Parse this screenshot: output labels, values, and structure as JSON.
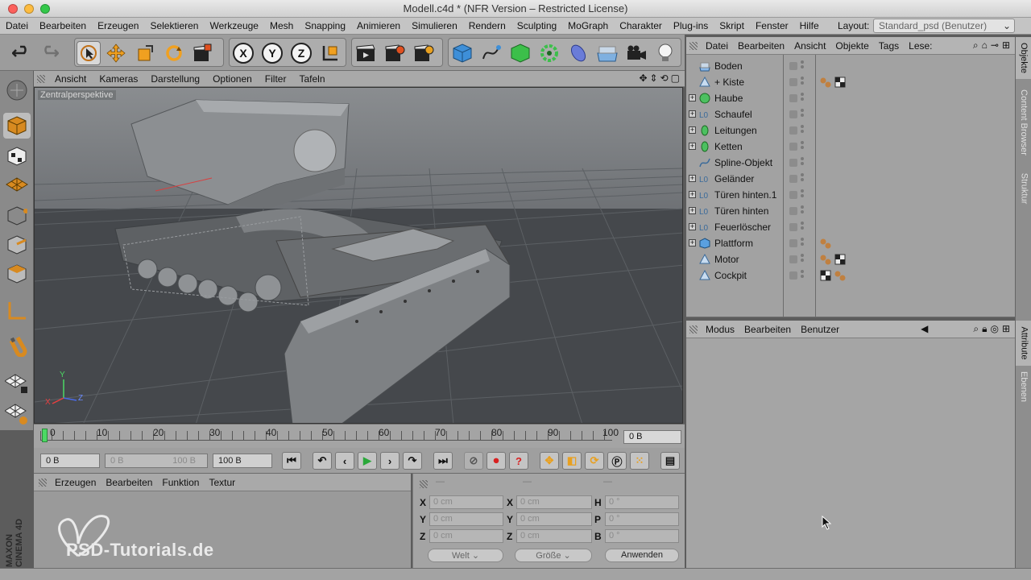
{
  "window": {
    "title": "Modell.c4d * (NFR Version – Restricted License)"
  },
  "menubar": {
    "items": [
      "Datei",
      "Bearbeiten",
      "Erzeugen",
      "Selektieren",
      "Werkzeuge",
      "Mesh",
      "Snapping",
      "Animieren",
      "Simulieren",
      "Rendern",
      "Sculpting",
      "MoGraph",
      "Charakter",
      "Plug-ins",
      "Skript",
      "Fenster",
      "Hilfe"
    ],
    "layout_label": "Layout:",
    "layout_value": "Standard_psd (Benutzer)"
  },
  "toolbar": {
    "axis_x": "X",
    "axis_y": "Y",
    "axis_z": "Z"
  },
  "viewport": {
    "menu": [
      "Ansicht",
      "Kameras",
      "Darstellung",
      "Optionen",
      "Filter",
      "Tafeln"
    ],
    "label": "Zentralperspektive",
    "axis_labels": {
      "x": "X",
      "y": "Y",
      "z": "Z"
    }
  },
  "timeline": {
    "ticks": [
      "0",
      "10",
      "20",
      "30",
      "40",
      "50",
      "60",
      "70",
      "80",
      "90",
      "100"
    ],
    "current_frame": "0 B"
  },
  "transport": {
    "start": "0 B",
    "range_start": "0 B",
    "range_end": "100 B",
    "end": "100 B"
  },
  "material_manager": {
    "menu": [
      "Erzeugen",
      "Bearbeiten",
      "Funktion",
      "Textur"
    ]
  },
  "coordinates": {
    "labels": [
      "X",
      "Y",
      "Z",
      "X",
      "Y",
      "Z",
      "H",
      "P",
      "B"
    ],
    "position": [
      "0 cm",
      "0 cm",
      "0 cm"
    ],
    "size": [
      "0 cm",
      "0 cm",
      "0 cm"
    ],
    "rotation": [
      "0 °",
      "0 °",
      "0 °"
    ],
    "headers": [
      "—",
      "—",
      "—"
    ],
    "mode": "Welt",
    "size_mode": "Größe",
    "apply": "Anwenden"
  },
  "branding": {
    "maxon": "MAXON CINEMA 4D",
    "watermark": "PSD-Tutorials.de"
  },
  "object_manager": {
    "menu": [
      "Datei",
      "Bearbeiten",
      "Ansicht",
      "Objekte",
      "Tags",
      "Lese:"
    ],
    "objects": [
      {
        "name": "Boden",
        "icon": "floor-icon",
        "expand": false,
        "tags": []
      },
      {
        "name": "+ Kiste",
        "icon": "polygon-icon",
        "expand": false,
        "tags": [
          "material-tag",
          "checker-tag"
        ]
      },
      {
        "name": "Haube",
        "icon": "generator-icon",
        "expand": true,
        "tags": []
      },
      {
        "name": "Schaufel",
        "icon": "null-icon",
        "expand": true,
        "tags": []
      },
      {
        "name": "Leitungen",
        "icon": "generator-icon",
        "expand": true,
        "tags": []
      },
      {
        "name": "Ketten",
        "icon": "generator-icon",
        "expand": true,
        "tags": []
      },
      {
        "name": "Spline-Objekt",
        "icon": "spline-icon",
        "expand": false,
        "tags": []
      },
      {
        "name": "Geländer",
        "icon": "null-icon",
        "expand": true,
        "tags": []
      },
      {
        "name": "Türen hinten.1",
        "icon": "null-icon",
        "expand": true,
        "tags": []
      },
      {
        "name": "Türen hinten",
        "icon": "null-icon",
        "expand": true,
        "tags": []
      },
      {
        "name": "Feuerlöscher",
        "icon": "null-icon",
        "expand": true,
        "tags": []
      },
      {
        "name": "Plattform",
        "icon": "cube-icon",
        "expand": true,
        "tags": [
          "material-tag"
        ]
      },
      {
        "name": "Motor",
        "icon": "polygon-icon",
        "expand": false,
        "tags": [
          "material-tag",
          "checker-tag"
        ]
      },
      {
        "name": "Cockpit",
        "icon": "polygon-icon",
        "expand": false,
        "tags": [
          "checker-tag",
          "material-tag"
        ]
      }
    ]
  },
  "attribute_manager": {
    "menu": [
      "Modus",
      "Bearbeiten",
      "Benutzer"
    ]
  },
  "right_tabs": [
    "Objekte",
    "Content Browser",
    "Struktur",
    "Attribute",
    "Ebenen"
  ],
  "colors": {
    "accent_orange": "#e8a020",
    "timeline_marker": "#4cd964",
    "viewport_bg": "#4b4e52"
  }
}
